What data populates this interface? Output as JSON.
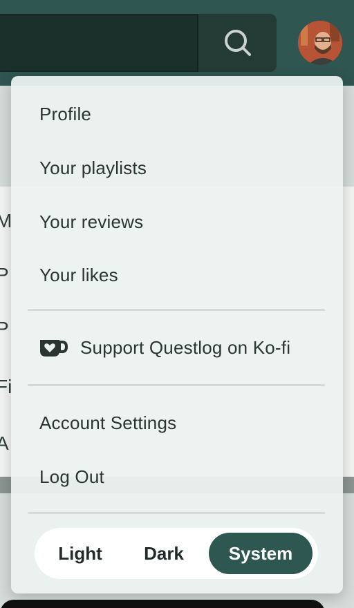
{
  "menu": {
    "items": [
      {
        "label": "Profile"
      },
      {
        "label": "Your playlists"
      },
      {
        "label": "Your reviews"
      },
      {
        "label": "Your likes"
      }
    ],
    "kofi": {
      "label": "Support Questlog on Ko-fi",
      "icon": "kofi-cup-heart-icon"
    },
    "account_items": [
      {
        "label": "Account Settings"
      },
      {
        "label": "Log Out"
      }
    ],
    "theme": {
      "options": [
        "Light",
        "Dark",
        "System"
      ],
      "selected": "System"
    }
  },
  "header": {
    "search_icon": "search-icon",
    "avatar": "user-avatar"
  },
  "background": {
    "letters": [
      "M",
      "P",
      "P",
      "Fi",
      "A"
    ]
  },
  "colors": {
    "header_bg": "#2f5650",
    "accent": "#2d5750",
    "menu_bg": "#ecf2f0",
    "text": "#2a3532"
  }
}
